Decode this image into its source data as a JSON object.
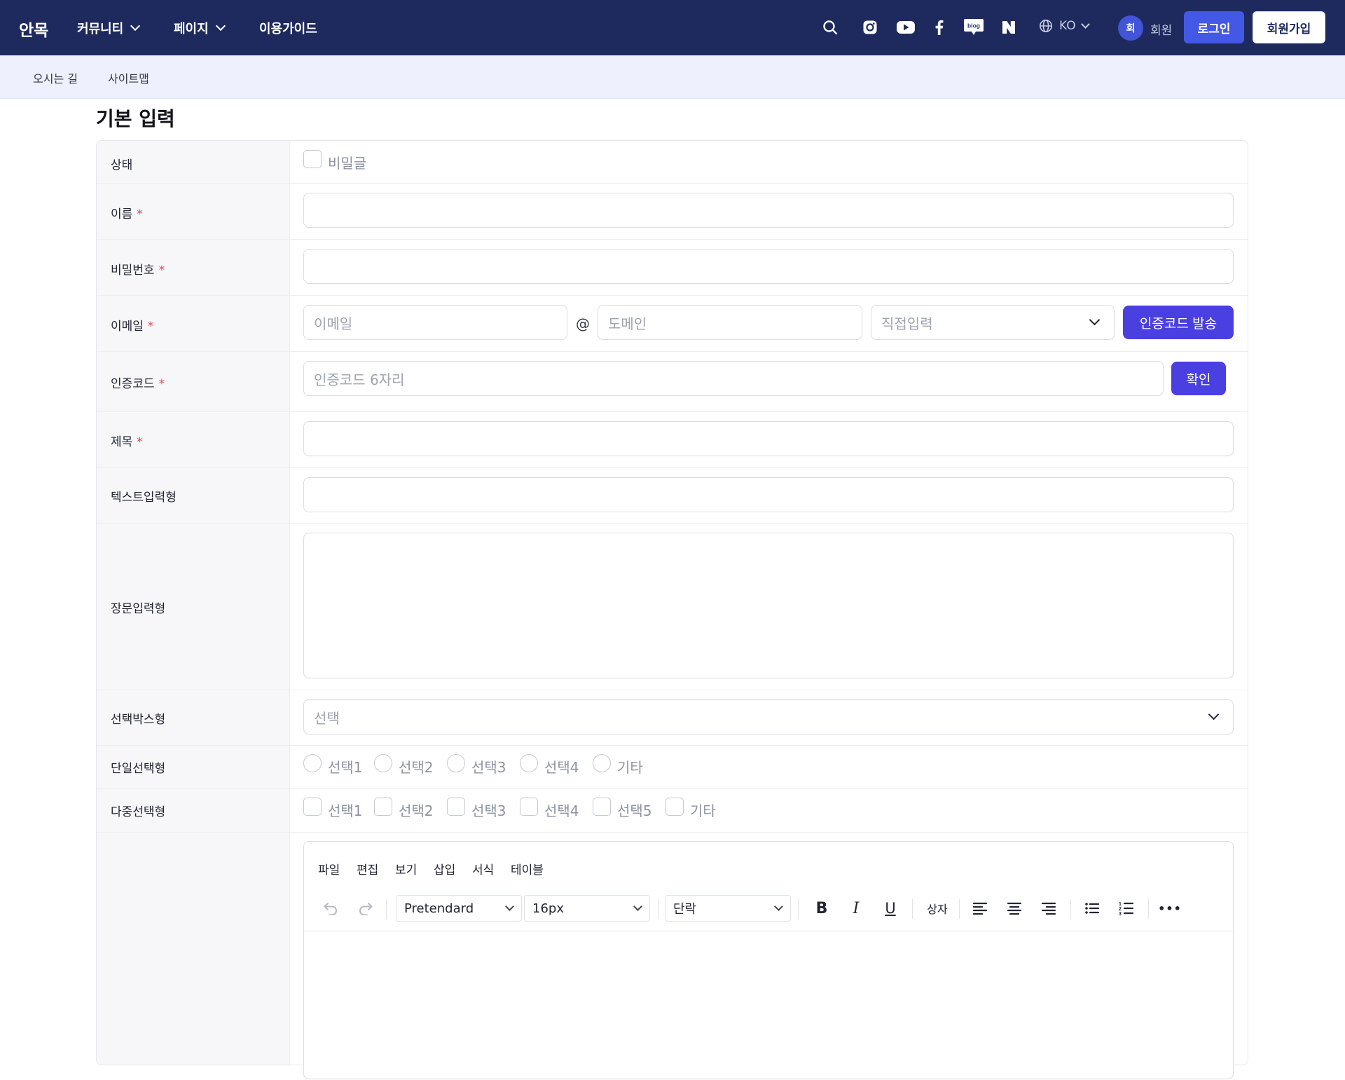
{
  "header": {
    "logo": "안목",
    "nav": [
      {
        "label": "커뮤니티",
        "has_dropdown": true
      },
      {
        "label": "페이지",
        "has_dropdown": true
      },
      {
        "label": "이용가이드",
        "has_dropdown": false
      }
    ],
    "icons": [
      "search-icon",
      "instagram-icon",
      "youtube-icon",
      "facebook-icon",
      "blog-icon",
      "naver-icon"
    ],
    "blog_icon_text": "blog",
    "naver_icon_text": "N",
    "language": "KO",
    "avatar_initial": "회",
    "member_label": "회원",
    "login_label": "로그인",
    "join_label": "회원가입"
  },
  "subnav": [
    "오시는 길",
    "사이트맵"
  ],
  "page_title": "기본 입력",
  "form": {
    "labels": {
      "status": "상태",
      "name": "이름",
      "password": "비밀번호",
      "email": "이메일",
      "auth_code": "인증코드",
      "title": "제목",
      "text_input": "텍스트입력형",
      "long_text": "장문입력형",
      "select_box": "선택박스형",
      "single_select": "단일선택형",
      "multi_select": "다중선택형"
    },
    "required_mark": "*",
    "secret_label": "비밀글",
    "email_placeholder": "이메일",
    "at_sign": "@",
    "domain_placeholder": "도메인",
    "domain_select": "직접입력",
    "send_code_label": "인증코드 발송",
    "code_placeholder": "인증코드 6자리",
    "confirm_label": "확인",
    "select_placeholder": "선택",
    "radio_options": [
      "선택1",
      "선택2",
      "선택3",
      "선택4",
      "기타"
    ],
    "checkbox_options": [
      "선택1",
      "선택2",
      "선택3",
      "선택4",
      "선택5",
      "기타"
    ]
  },
  "editor": {
    "menus": [
      "파일",
      "편집",
      "보기",
      "삽입",
      "서식",
      "테이블"
    ],
    "font_family": "Pretendard",
    "font_size": "16px",
    "block_format": "단락",
    "box_label": "상자",
    "bold_glyph": "B",
    "italic_glyph": "I",
    "underline_glyph": "U",
    "more_glyph": "•••"
  },
  "colors": {
    "header_bg": "#1e2a5e",
    "subbar_bg": "#eef0fd",
    "primary": "#4a3fe0",
    "login_btn": "#4458e6",
    "required": "#e5484d"
  }
}
